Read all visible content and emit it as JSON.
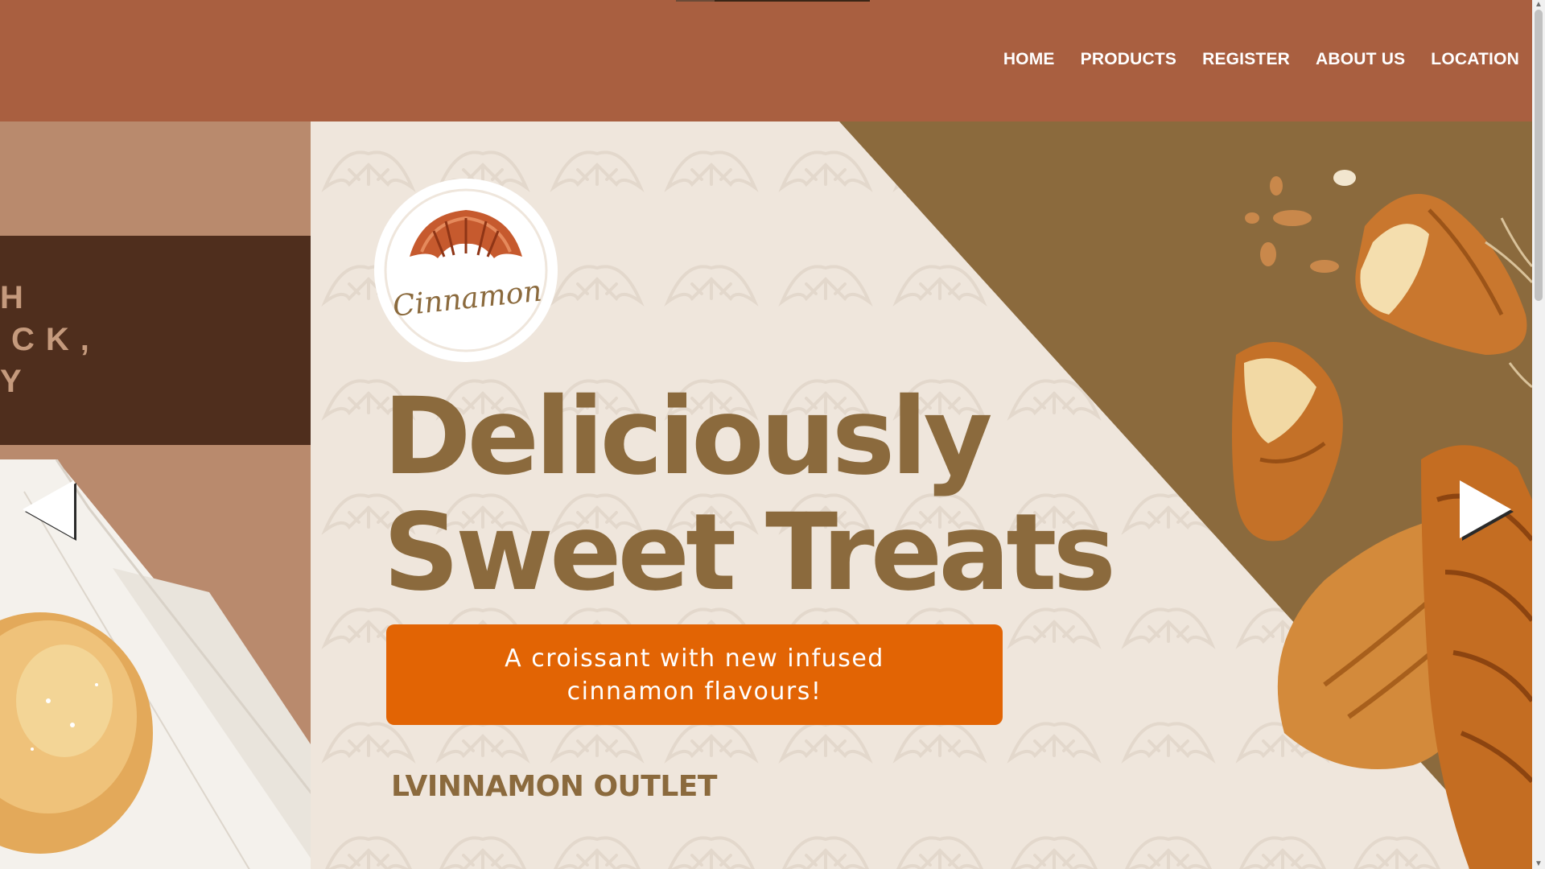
{
  "nav": {
    "links": [
      "HOME",
      "PRODUCTS",
      "REGISTER",
      "ABOUT US",
      "LOCATION"
    ]
  },
  "prev_slide": {
    "lines": [
      "H",
      "CK,",
      "Y"
    ]
  },
  "hero": {
    "headline_line1": "Deliciously",
    "headline_line2": "Sweet Treats",
    "promo": "A croissant with new infused cinnamon flavours!",
    "outlet": "LVINNAMON OUTLET",
    "logo_text": "Cinnamon"
  },
  "icons": {
    "prev": "left-triangle-arrow-icon",
    "next": "right-triangle-arrow-icon"
  },
  "colors": {
    "navbar": "#a95f40",
    "headline": "#8b6a3d",
    "promo": "#e26404",
    "background": "#efe6dc",
    "diagonal": "#8b6a3d"
  }
}
